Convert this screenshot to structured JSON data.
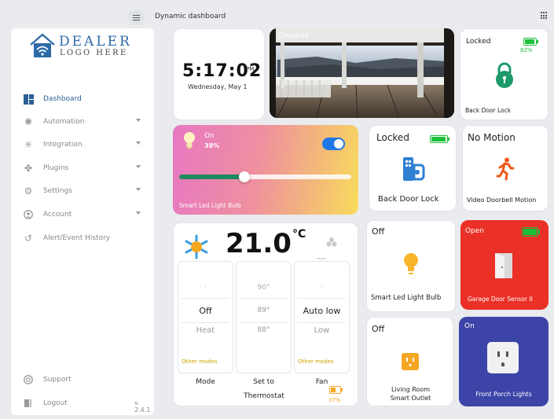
{
  "header": {
    "title": "Dynamic dashboard"
  },
  "logo": {
    "line1": "DEALER",
    "line2": "LOGO HERE"
  },
  "sidebar": {
    "items": [
      {
        "label": "Dashboard",
        "icon": "dashboard-icon",
        "active": true
      },
      {
        "label": "Automation",
        "icon": "automation-icon",
        "expandable": true
      },
      {
        "label": "Integration",
        "icon": "integration-icon",
        "expandable": true
      },
      {
        "label": "Plugins",
        "icon": "puzzle-icon",
        "expandable": true
      },
      {
        "label": "Settings",
        "icon": "gear-icon",
        "expandable": true
      },
      {
        "label": "Account",
        "icon": "user-icon",
        "expandable": true
      },
      {
        "label": "Alert/Event History",
        "icon": "history-icon"
      }
    ],
    "support": "Support",
    "logout": "Logout",
    "version": "v. 2.4.1"
  },
  "clock": {
    "time": "5:17:02",
    "ampm": "PM",
    "date": "Wednesday, May 1"
  },
  "doorbell": {
    "title": "Doorbell"
  },
  "back_door_small": {
    "status": "Locked",
    "battery": "82%",
    "name": "Back Door Lock"
  },
  "smart_light": {
    "state": "On",
    "level": "38%",
    "level_fraction": 0.38,
    "name": "Smart Led Light Bulb"
  },
  "back_door_lock": {
    "status": "Locked",
    "name": "Back Door Lock"
  },
  "motion": {
    "status": "No Motion",
    "name": "Video Doorbell Motion"
  },
  "thermostat": {
    "temperature": "21.0",
    "unit": "°C",
    "mode": {
      "top": ".",
      "current": "Off",
      "next": "Heat",
      "other": "Other modes"
    },
    "setpoint": {
      "top": "90°",
      "current": "89°",
      "next": "88°"
    },
    "fan": {
      "top": ".",
      "current": "Auto low",
      "next": "Low",
      "other": "Other modes"
    },
    "labels": {
      "mode": "Mode",
      "set_to": "Set to",
      "fan": "Fan"
    },
    "name": "Thermostat",
    "battery": "37%"
  },
  "led_bulb_off": {
    "state": "Off",
    "name": "Smart Led Light Bulb"
  },
  "garage": {
    "state": "Open",
    "name": "Garage Door Sensor II"
  },
  "outlet": {
    "state": "Off",
    "name_line1": "Living Room",
    "name_line2": "Smart Outlet"
  },
  "porch": {
    "state": "On",
    "name": "Front Porch Lights"
  },
  "colors": {
    "accent": "#2c5f97",
    "toggle": "#1e78e6",
    "amber": "#f5a623",
    "green": "#1fbf3a",
    "red": "#ea3027",
    "navy": "#3c44a8"
  }
}
